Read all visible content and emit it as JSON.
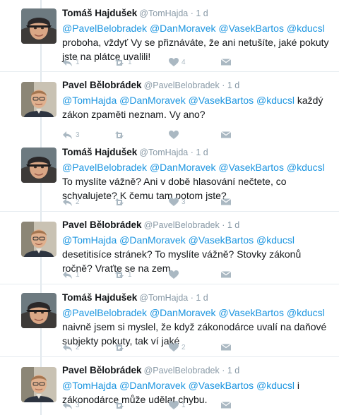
{
  "tweets": [
    {
      "author": "Tomáš Hajdušek",
      "handle": "@TomHajda",
      "time": "1 d",
      "mentions": "@PavelBelobradek @DanMoravek @VasekBartos @kducsl",
      "body": "proboha, vždyť Vy se přiznáváte, že ani netušíte, jaké pokuty jste na plátce uvalili!",
      "replies": "1",
      "retweets": "1",
      "likes": "4"
    },
    {
      "author": "Pavel Bělobrádek",
      "handle": "@PavelBelobradek",
      "time": "1 d",
      "mentions": "@TomHajda @DanMoravek @VasekBartos @kducsl",
      "body": "každý zákon zpaměti neznam. Vy ano?",
      "replies": "3",
      "retweets": "",
      "likes": ""
    },
    {
      "author": "Tomáš Hajdušek",
      "handle": "@TomHajda",
      "time": "1 d",
      "mentions": "@PavelBelobradek @DanMoravek @VasekBartos @kducsl",
      "body": "To myslíte vážně? Ani v době hlasování nečtete, co schvalujete? K čemu tam potom jste?",
      "replies": "2",
      "retweets": "",
      "likes": "3"
    },
    {
      "author": "Pavel Bělobrádek",
      "handle": "@PavelBelobradek",
      "time": "1 d",
      "mentions": "@TomHajda @DanMoravek @VasekBartos @kducsl",
      "body": "desetitisíce stránek? To myslíte vážně? Stovky zákonů ročně? Vraťte se na zem",
      "replies": "1",
      "retweets": "1",
      "likes": ""
    },
    {
      "author": "Tomáš Hajdušek",
      "handle": "@TomHajda",
      "time": "1 d",
      "mentions": "@PavelBelobradek @DanMoravek @VasekBartos @kducsl",
      "body": "naivně jsem si myslel, že když zákonodárce uvalí na daňové subjekty pokuty, tak ví jaké",
      "replies": "2",
      "retweets": "",
      "likes": "2"
    },
    {
      "author": "Pavel Bělobrádek",
      "handle": "@PavelBelobradek",
      "time": "1 d",
      "mentions": "@TomHajda @DanMoravek @VasekBartos @kducsl",
      "body": "i zákonodárce může udělat chybu.",
      "replies": "3",
      "retweets": "",
      "likes": "1"
    }
  ],
  "icons": {
    "reply": "reply-icon",
    "retweet": "retweet-icon",
    "like": "heart-icon",
    "dm": "envelope-icon",
    "avatar_tomas": "avatar-tomas",
    "avatar_pavel": "avatar-pavel"
  },
  "colors": {
    "link": "#1b95e0",
    "meta": "#8899a6",
    "icon": "#aab8c2",
    "text": "#14171a",
    "divider": "#e6ecf0"
  }
}
